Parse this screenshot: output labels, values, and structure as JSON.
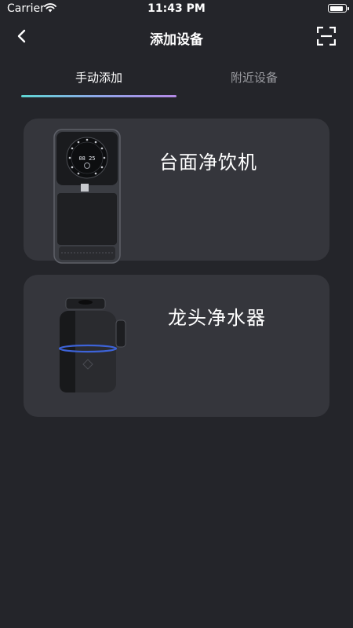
{
  "status_bar": {
    "carrier": "Carrier",
    "time": "11:43 PM",
    "battery_level": 0.9
  },
  "nav": {
    "title": "添加设备",
    "back_icon": "chevron-left-icon",
    "scan_icon": "scan-frame-icon"
  },
  "tabs": [
    {
      "label": "手动添加",
      "active": true
    },
    {
      "label": "附近设备",
      "active": false
    }
  ],
  "devices": [
    {
      "name": "台面净饮机",
      "display_text": "08 25"
    },
    {
      "name": "龙头净水器"
    }
  ],
  "colors": {
    "background": "#24252a",
    "card": "#35363c",
    "tab_indicator": [
      "#5fd6d3",
      "#8fa6e8",
      "#b489e6"
    ],
    "inactive_tab": "#9a9ba0"
  }
}
